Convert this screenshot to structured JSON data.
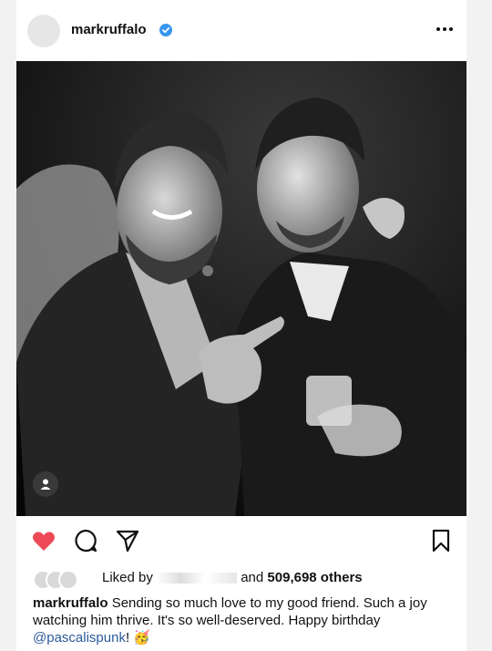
{
  "post": {
    "username": "markruffalo",
    "verified_icon": "verified-badge-icon",
    "more_icon": "more-options-icon",
    "image_alt": "Black and white photo of two men at a party",
    "tag_icon": "user-tag-icon"
  },
  "actions": {
    "like_icon": "heart-filled-icon",
    "comment_icon": "comment-icon",
    "share_icon": "send-icon",
    "save_icon": "bookmark-icon",
    "like_color": "#ed4956"
  },
  "likes": {
    "prefix": "Liked by",
    "suffix": "and",
    "count": "509,698 others"
  },
  "caption": {
    "username": "markruffalo",
    "text": " Sending so much love to my good friend. Such a joy watching him thrive. It's so well-deserved. Happy birthday ",
    "mention": "@pascalispunk",
    "end": "! 🥳"
  }
}
